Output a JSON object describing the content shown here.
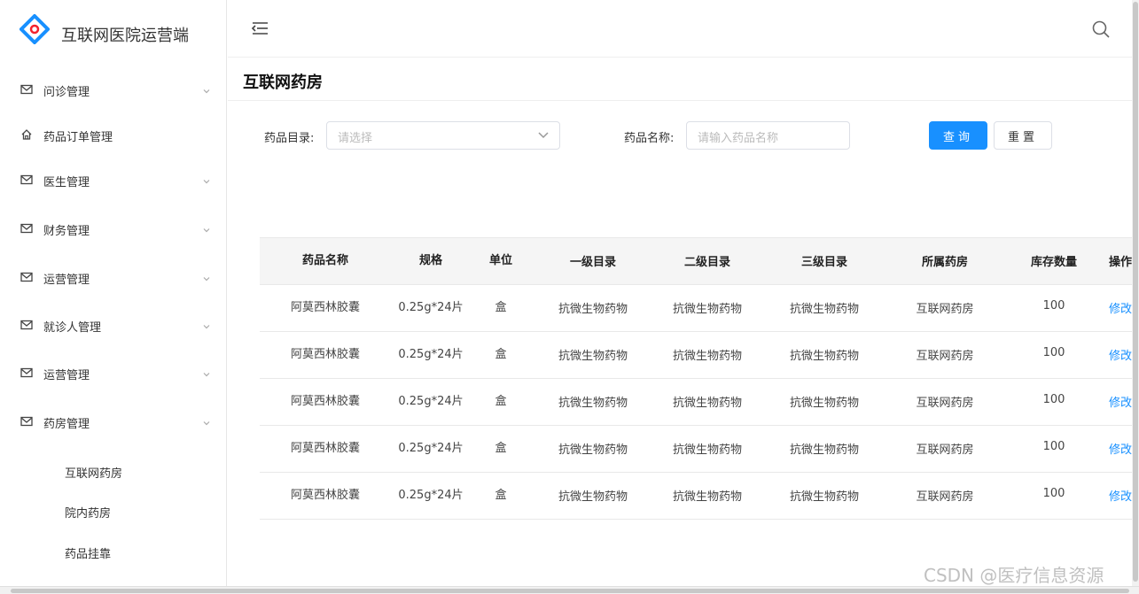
{
  "app": {
    "title": "互联网医院运营端"
  },
  "sidebar": {
    "items": [
      {
        "label": "问诊管理",
        "icon": "mail-icon",
        "expandable": true
      },
      {
        "label": "药品订单管理",
        "icon": "home-icon",
        "expandable": false
      },
      {
        "label": "医生管理",
        "icon": "mail-icon",
        "expandable": true
      },
      {
        "label": "财务管理",
        "icon": "mail-icon",
        "expandable": true
      },
      {
        "label": "运营管理",
        "icon": "mail-icon",
        "expandable": true
      },
      {
        "label": "就诊人管理",
        "icon": "mail-icon",
        "expandable": true
      },
      {
        "label": "运营管理",
        "icon": "mail-icon",
        "expandable": true
      },
      {
        "label": "药房管理",
        "icon": "mail-icon",
        "expandable": true
      }
    ],
    "sub_items": [
      {
        "label": "互联网药房"
      },
      {
        "label": "院内药房"
      },
      {
        "label": "药品挂靠"
      }
    ]
  },
  "page": {
    "title": "互联网药房"
  },
  "filters": {
    "category_label": "药品目录:",
    "category_placeholder": "请选择",
    "name_label": "药品名称:",
    "name_placeholder": "请输入药品名称",
    "query_button": "查询",
    "reset_button": "重置"
  },
  "table": {
    "columns": [
      "药品名称",
      "规格",
      "单位",
      "一级目录",
      "二级目录",
      "三级目录",
      "所属药房",
      "库存数量",
      "操作"
    ],
    "rows": [
      [
        "阿莫西林胶囊",
        "0.25g*24片",
        "盒",
        "抗微生物药物",
        "抗微生物药物",
        "抗微生物药物",
        "互联网药房",
        "100",
        "修改"
      ],
      [
        "阿莫西林胶囊",
        "0.25g*24片",
        "盒",
        "抗微生物药物",
        "抗微生物药物",
        "抗微生物药物",
        "互联网药房",
        "100",
        "修改"
      ],
      [
        "阿莫西林胶囊",
        "0.25g*24片",
        "盒",
        "抗微生物药物",
        "抗微生物药物",
        "抗微生物药物",
        "互联网药房",
        "100",
        "修改"
      ],
      [
        "阿莫西林胶囊",
        "0.25g*24片",
        "盒",
        "抗微生物药物",
        "抗微生物药物",
        "抗微生物药物",
        "互联网药房",
        "100",
        "修改"
      ],
      [
        "阿莫西林胶囊",
        "0.25g*24片",
        "盒",
        "抗微生物药物",
        "抗微生物药物",
        "抗微生物药物",
        "互联网药房",
        "100",
        "修改"
      ]
    ]
  },
  "watermark": "CSDN @医疗信息资源",
  "colors": {
    "primary": "#1890ff",
    "logo_blue": "#1890ff",
    "logo_red": "#f5222d"
  }
}
